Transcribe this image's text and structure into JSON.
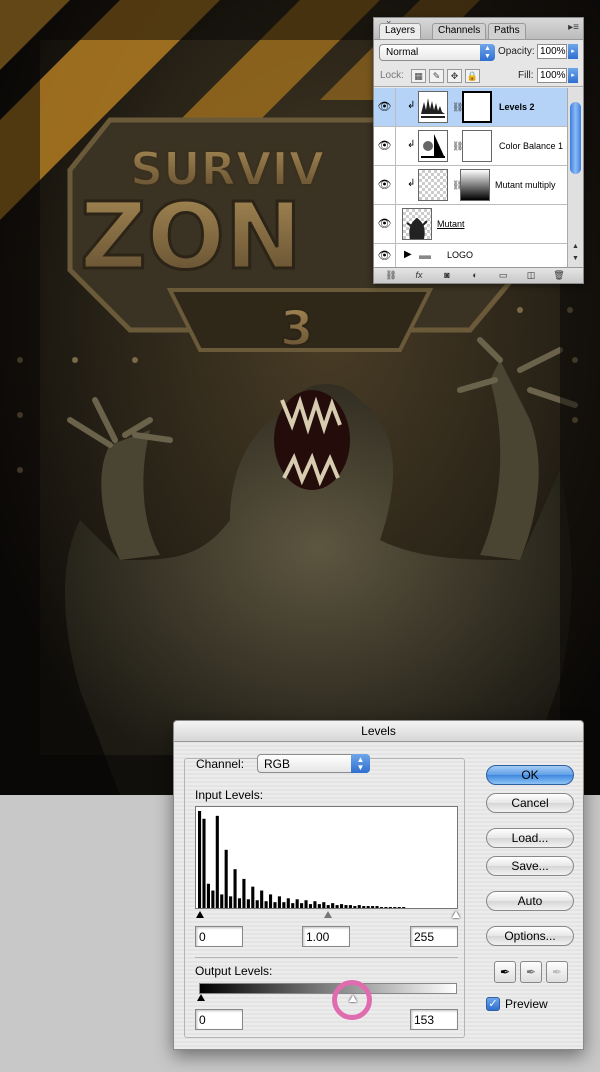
{
  "artwork": {
    "logo_top": "SURVIV",
    "logo_main": "ZON",
    "logo_number": "3"
  },
  "layers_panel": {
    "tabs": [
      {
        "label": "Layers",
        "active": true
      },
      {
        "label": "Channels",
        "active": false
      },
      {
        "label": "Paths",
        "active": false
      }
    ],
    "close_glyph": "×",
    "blend_mode": "Normal",
    "opacity_label": "Opacity:",
    "opacity_value": "100%",
    "lock_label": "Lock:",
    "fill_label": "Fill:",
    "fill_value": "100%",
    "layers": [
      {
        "name": "Levels 2",
        "visible": true,
        "selected": true,
        "clipped": true,
        "kind": "adjustment"
      },
      {
        "name": "Color Balance 1",
        "visible": true,
        "selected": false,
        "clipped": true,
        "kind": "adjustment"
      },
      {
        "name": "Mutant multiply",
        "visible": true,
        "selected": false,
        "clipped": true,
        "kind": "masked"
      },
      {
        "name": "Mutant",
        "visible": true,
        "selected": false,
        "clipped": false,
        "kind": "image"
      },
      {
        "name": "LOGO",
        "visible": true,
        "selected": false,
        "clipped": false,
        "kind": "group"
      }
    ],
    "bottom_icons": [
      "link-icon",
      "fx-icon",
      "mask-icon",
      "adjustment-icon",
      "folder-icon",
      "new-layer-icon",
      "trash-icon"
    ],
    "bottom_glyphs": [
      "⛓",
      "fx",
      "◙",
      "◐",
      "▭",
      "◫",
      "🗑"
    ]
  },
  "levels_dialog": {
    "title": "Levels",
    "channel_label": "Channel:",
    "channel_value": "RGB",
    "input_levels_label": "Input Levels:",
    "input_black": "0",
    "input_gamma": "1.00",
    "input_white": "255",
    "output_levels_label": "Output Levels:",
    "output_black": "0",
    "output_white": "153",
    "buttons": {
      "ok": "OK",
      "cancel": "Cancel",
      "load": "Load...",
      "save": "Save...",
      "auto": "Auto",
      "options": "Options..."
    },
    "preview_label": "Preview",
    "preview_checked": true,
    "histogram_values": [
      100,
      92,
      25,
      18,
      95,
      14,
      60,
      12,
      40,
      10,
      30,
      9,
      22,
      8,
      18,
      7,
      14,
      6,
      12,
      6,
      10,
      5,
      9,
      5,
      8,
      4,
      7,
      4,
      6,
      3,
      5,
      3,
      4,
      3,
      3,
      2,
      3,
      2,
      2,
      2,
      2,
      1,
      1,
      1,
      1,
      1,
      1,
      0,
      0,
      0
    ]
  }
}
